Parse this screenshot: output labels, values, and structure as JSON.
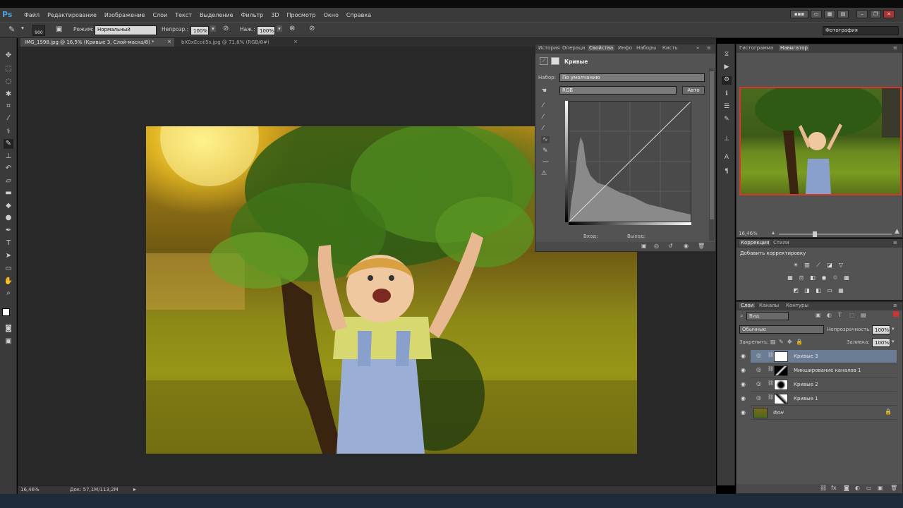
{
  "app": {
    "logo": "Ps"
  },
  "menu": [
    "Файл",
    "Редактирование",
    "Изображение",
    "Слои",
    "Текст",
    "Выделение",
    "Фильтр",
    "3D",
    "Просмотр",
    "Окно",
    "Справка"
  ],
  "options": {
    "brush_size": "900",
    "mode_label": "Режим:",
    "mode_value": "Нормальный",
    "opacity_label": "Непрозр.:",
    "opacity_value": "100%",
    "pressure_label": "Наж.:",
    "pressure_value": "100%",
    "workspace": "Фотография"
  },
  "doc_tabs": [
    {
      "label": "IMG_1598.jpg @ 16,5% (Кривые 3, Слой-маска/8) *",
      "active": true
    },
    {
      "label": "bX0xEcoiI5s.jpg @ 71,8% (RGB/8#)",
      "active": false
    }
  ],
  "status": {
    "zoom": "16,46%",
    "doc": "Док: 57,1M/113,2M"
  },
  "properties": {
    "tabs": [
      "История",
      "Операци",
      "Свойства",
      "Инфо",
      "Наборы",
      "Кисть"
    ],
    "active_tab": "Свойства",
    "title": "Кривые",
    "preset_label": "Набор:",
    "preset_value": "По умолчанию",
    "channel": "RGB",
    "auto_button": "Авто",
    "input_label": "Вход:",
    "output_label": "Выход:"
  },
  "navigator": {
    "tabs": [
      "Гистограмма",
      "Навигатор"
    ],
    "active_tab": "Навигатор",
    "zoom": "16,46%"
  },
  "adjustments": {
    "tabs": [
      "Коррекция",
      "Стили"
    ],
    "title": "Добавить корректировку"
  },
  "layers": {
    "tabs": [
      "Слои",
      "Каналы",
      "Контуры"
    ],
    "filter": "Вид",
    "blend_mode": "Обычные",
    "opacity_label": "Непрозрачность:",
    "opacity_value": "100%",
    "lock_label": "Закрепить:",
    "fill_label": "Заливка:",
    "fill_value": "100%",
    "items": [
      {
        "name": "Кривые 3",
        "selected": true
      },
      {
        "name": "Микширование каналов 1",
        "selected": false
      },
      {
        "name": "Кривые 2",
        "selected": false
      },
      {
        "name": "Кривые 1",
        "selected": false
      },
      {
        "name": "Фон",
        "selected": false
      }
    ]
  },
  "colors": {
    "accent": "#d43a2a",
    "selection": "#6b7c95"
  }
}
